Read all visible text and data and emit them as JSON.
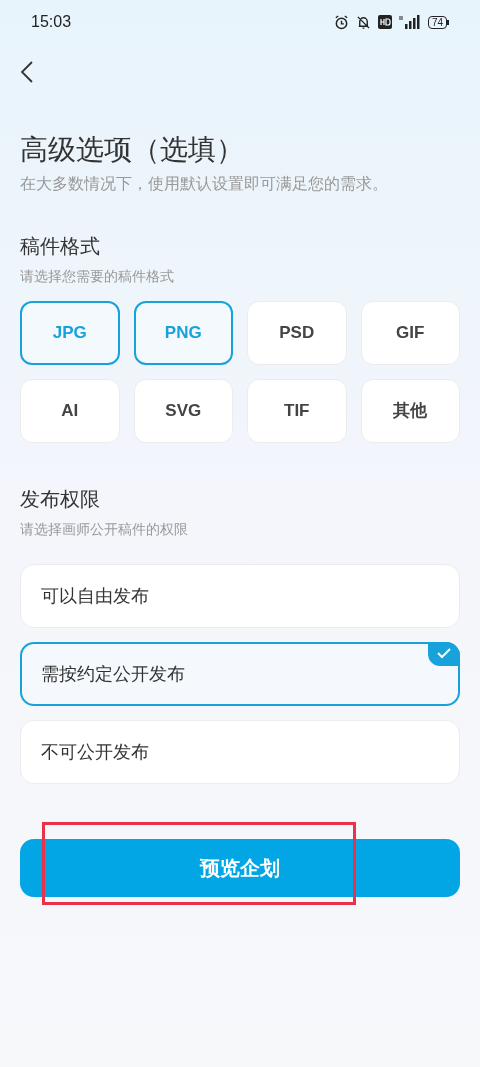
{
  "status_bar": {
    "time": "15:03",
    "battery": "74"
  },
  "title": "高级选项（选填）",
  "subtitle": "在大多数情况下，使用默认设置即可满足您的需求。",
  "format_section": {
    "title": "稿件格式",
    "hint": "请选择您需要的稿件格式",
    "options": [
      {
        "label": "JPG",
        "selected": true
      },
      {
        "label": "PNG",
        "selected": true
      },
      {
        "label": "PSD",
        "selected": false
      },
      {
        "label": "GIF",
        "selected": false
      },
      {
        "label": "AI",
        "selected": false
      },
      {
        "label": "SVG",
        "selected": false
      },
      {
        "label": "TIF",
        "selected": false
      },
      {
        "label": "其他",
        "selected": false
      }
    ]
  },
  "permission_section": {
    "title": "发布权限",
    "hint": "请选择画师公开稿件的权限",
    "options": [
      {
        "label": "可以自由发布",
        "selected": false
      },
      {
        "label": "需按约定公开发布",
        "selected": true
      },
      {
        "label": "不可公开发布",
        "selected": false
      }
    ]
  },
  "primary_button": {
    "label": "预览企划",
    "highlighted": true
  }
}
